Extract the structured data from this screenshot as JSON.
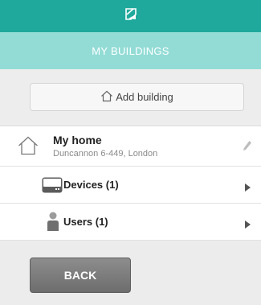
{
  "header": {
    "logo_icon": "building-logo-icon",
    "title": "MY BUILDINGS"
  },
  "add_building": {
    "icon": "house-icon",
    "label": "Add building"
  },
  "building": {
    "icon": "house-icon",
    "name": "My home",
    "address": "Duncannon 6-449, London",
    "edit_icon": "pencil-icon"
  },
  "sub_items": [
    {
      "icon": "device-icon",
      "label": "Devices (1)",
      "chevron": "chevron-right-icon"
    },
    {
      "icon": "user-icon",
      "label": "Users (1)",
      "chevron": "chevron-right-icon"
    }
  ],
  "back_label": "BACK",
  "colors": {
    "topbar": "#1fa99c",
    "subtitle_bar": "#93dcd6",
    "background": "#ededed",
    "back_button": "#7a7a7a"
  }
}
